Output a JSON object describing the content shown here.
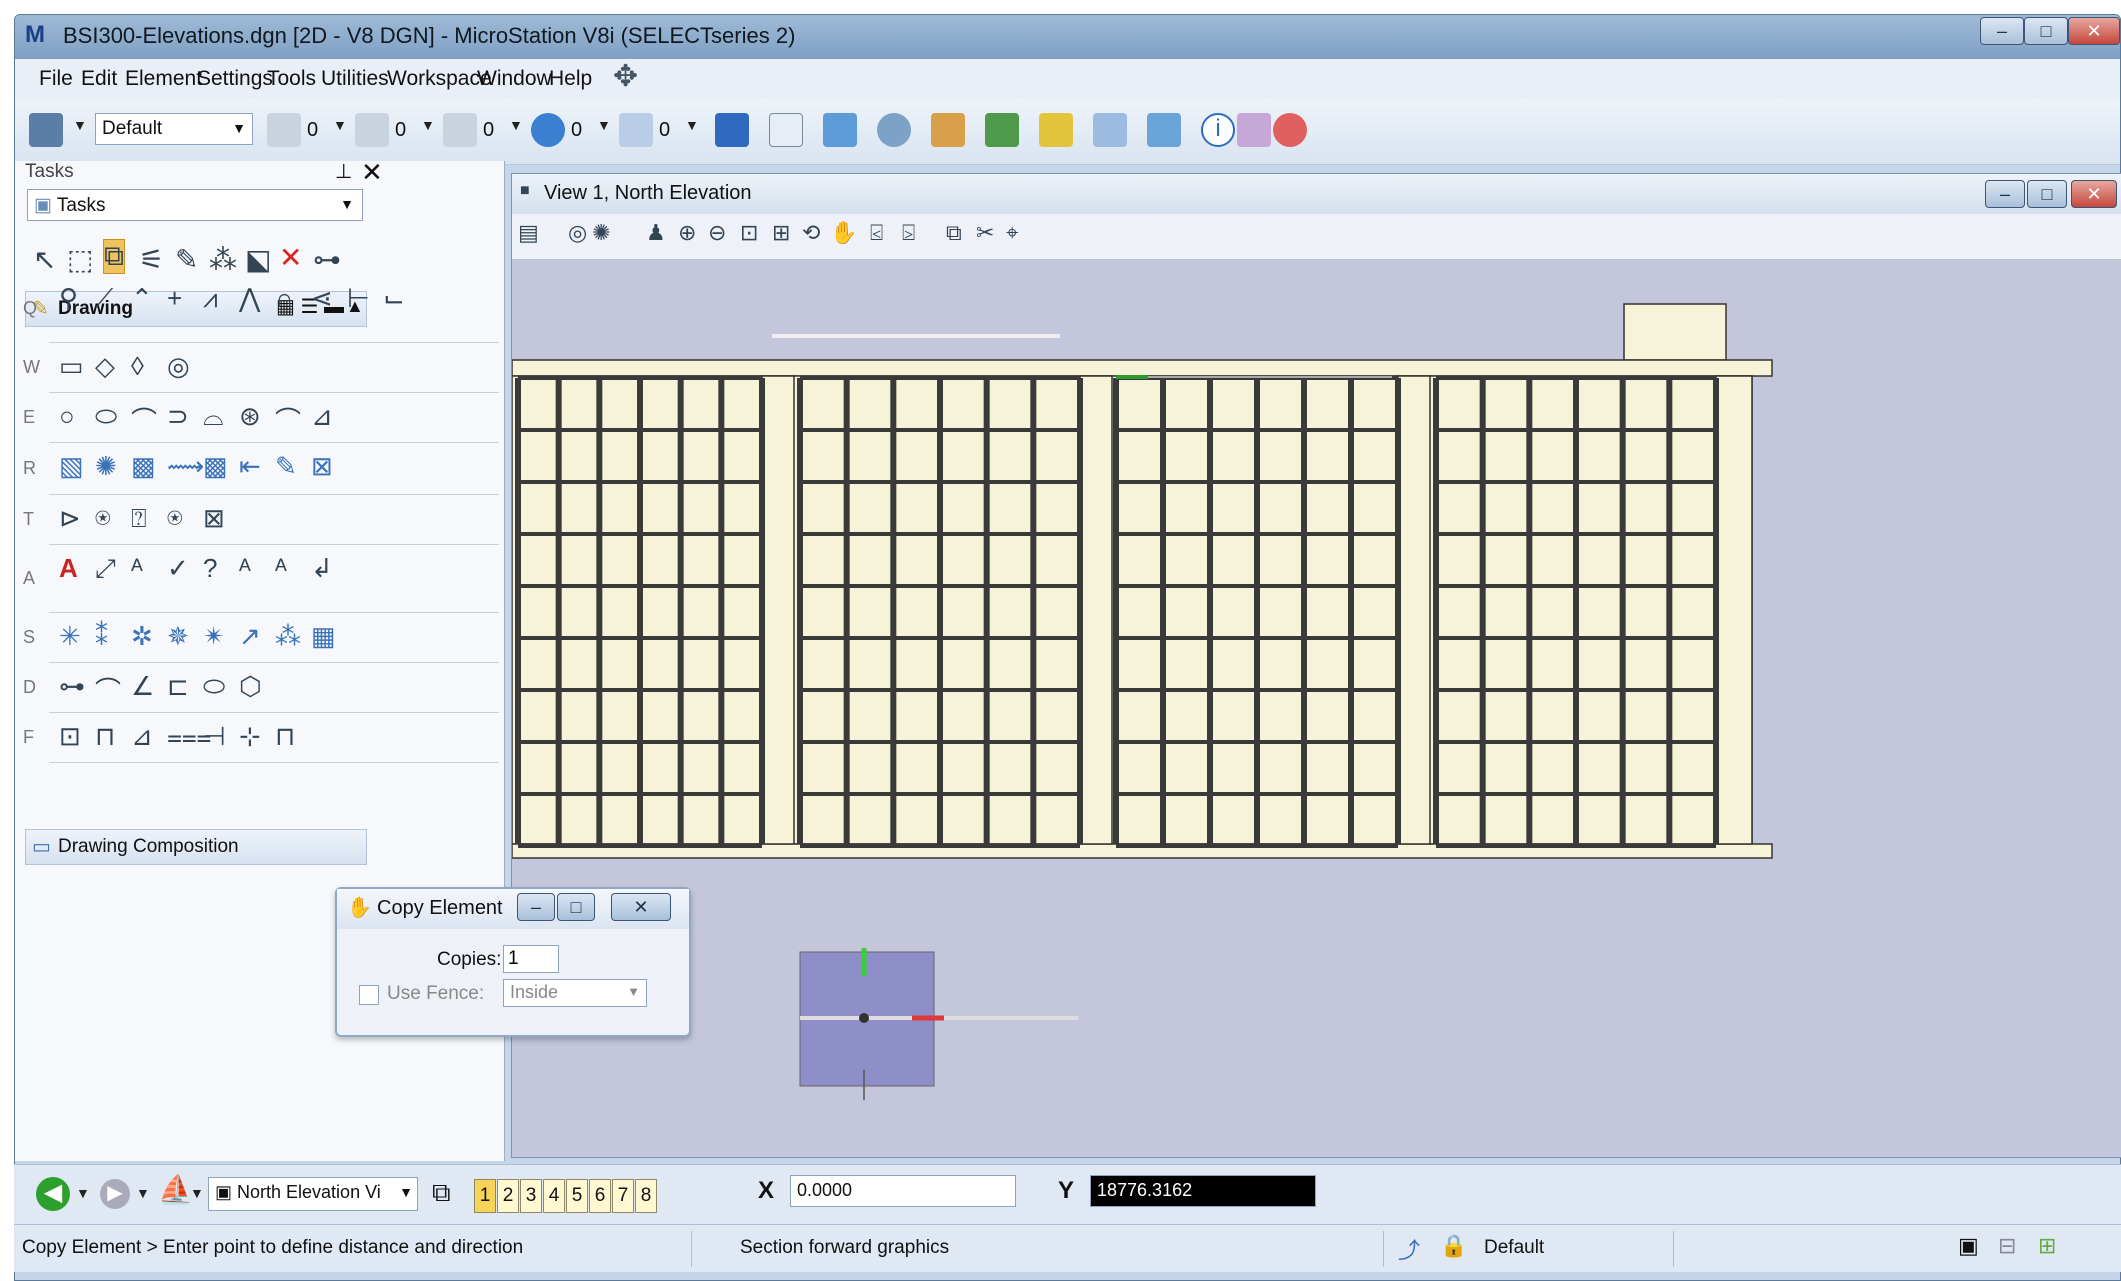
{
  "window": {
    "title": "BSI300-Elevations.dgn [2D - V8 DGN] - MicroStation V8i (SELECTseries 2)"
  },
  "menu": [
    "File",
    "Edit",
    "Element",
    "Settings",
    "Tools",
    "Utilities",
    "Workspace",
    "Window",
    "Help"
  ],
  "toolbar": {
    "level_combo": "Default",
    "counts": [
      "0",
      "0",
      "0",
      "0",
      "0"
    ]
  },
  "tasks": {
    "panel_title": "Tasks",
    "selector": "Tasks",
    "drawing_header": "Drawing",
    "row_letters": [
      "Q",
      "W",
      "E",
      "R",
      "T",
      "A",
      "S",
      "D",
      "F"
    ],
    "drawing_composition": "Drawing Composition"
  },
  "view": {
    "title": "View 1, North Elevation"
  },
  "dialog": {
    "title": "Copy Element",
    "copies_label": "Copies:",
    "copies_value": "1",
    "fence_label": "Use Fence:",
    "fence_mode": "Inside"
  },
  "status": {
    "view_combo": "North Elevation Vi",
    "view_numbers": [
      "1",
      "2",
      "3",
      "4",
      "5",
      "6",
      "7",
      "8"
    ],
    "x_label": "X",
    "x_value": "0.0000",
    "y_label": "Y",
    "y_value": "18776.3162",
    "prompt": "Copy Element > Enter point to define distance and direction",
    "message": "Section forward graphics",
    "level": "Default"
  },
  "colors": {
    "building_fill": "#f6f3d8",
    "view_bg": "#c4c6db",
    "dialog_marker": "#8e8ec9",
    "x_axis": "#e03838",
    "y_axis": "#3ad03a"
  }
}
